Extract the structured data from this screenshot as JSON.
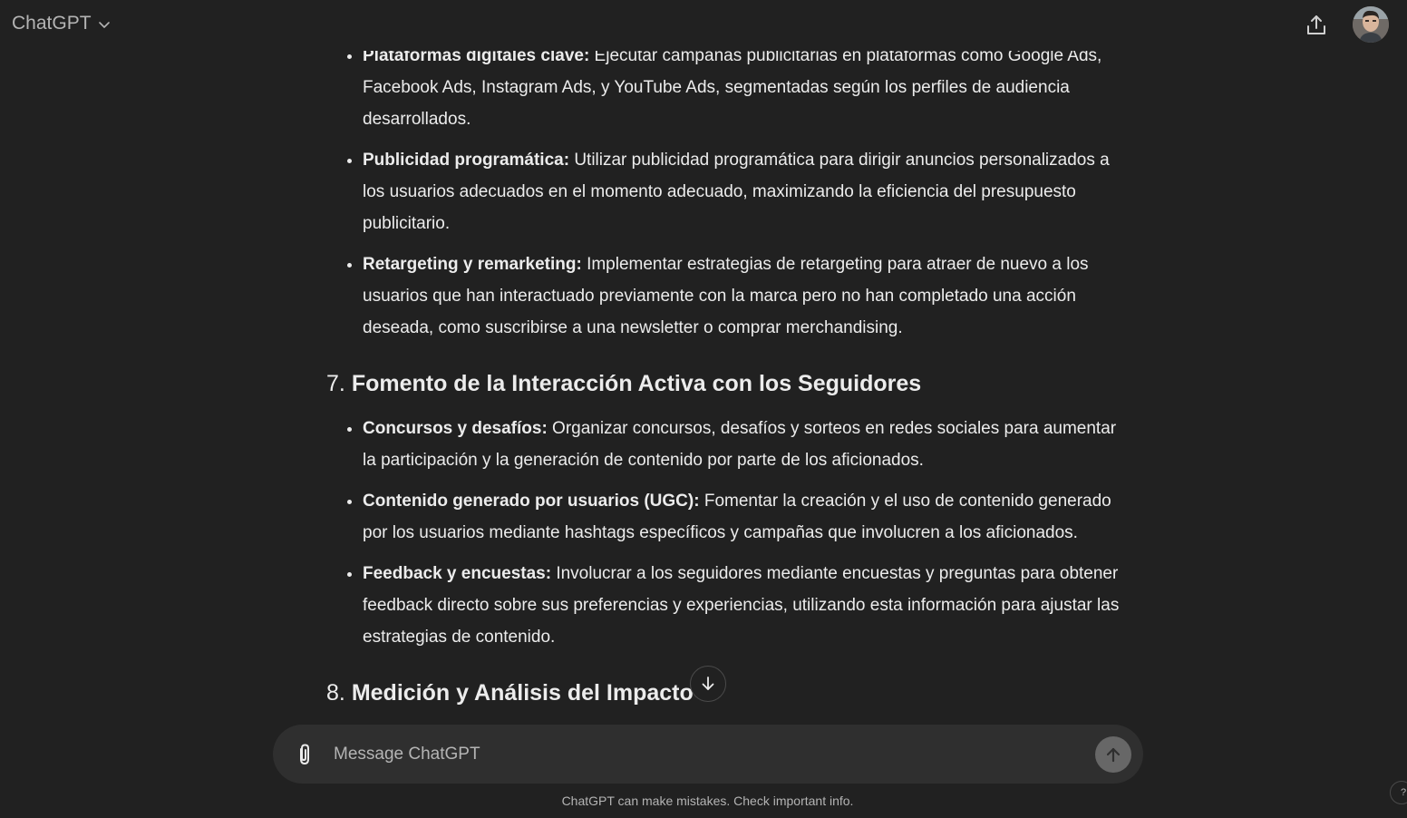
{
  "header": {
    "model_name": "ChatGPT",
    "icons": {
      "model_dropdown": "chevron-down-icon",
      "share": "share-icon",
      "avatar": "user-avatar"
    }
  },
  "message": {
    "section6_bullets": [
      {
        "title": "Plataformas digitales clave:",
        "text": " Ejecutar campañas publicitarias en plataformas como Google Ads, Facebook Ads, Instagram Ads, y YouTube Ads, segmentadas según los perfiles de audiencia desarrollados."
      },
      {
        "title": "Publicidad programática:",
        "text": " Utilizar publicidad programática para dirigir anuncios personalizados a los usuarios adecuados en el momento adecuado, maximizando la eficiencia del presupuesto publicitario."
      },
      {
        "title": "Retargeting y remarketing:",
        "text": " Implementar estrategias de retargeting para atraer de nuevo a los usuarios que han interactuado previamente con la marca pero no han completado una acción deseada, como suscribirse a una newsletter o comprar merchandising."
      }
    ],
    "section7": {
      "number": "7.",
      "heading": "Fomento de la Interacción Activa con los Seguidores",
      "bullets": [
        {
          "title": "Concursos y desafíos:",
          "text": " Organizar concursos, desafíos y sorteos en redes sociales para aumentar la participación y la generación de contenido por parte de los aficionados."
        },
        {
          "title": "Contenido generado por usuarios (UGC):",
          "text": " Fomentar la creación y el uso de contenido generado por los usuarios mediante hashtags específicos y campañas que involucren a los aficionados."
        },
        {
          "title": "Feedback y encuestas:",
          "text": " Involucrar a los seguidores mediante encuestas y preguntas para obtener feedback directo sobre sus preferencias y experiencias, utilizando esta información para ajustar las estrategias de contenido."
        }
      ]
    },
    "section8": {
      "number": "8.",
      "heading": "Medición y Análisis del Impacto"
    }
  },
  "composer": {
    "placeholder": "Message ChatGPT",
    "value": "",
    "icons": {
      "attach": "paperclip-icon",
      "send": "arrow-up-icon",
      "scroll": "arrow-down-icon"
    }
  },
  "footer": {
    "disclaimer": "ChatGPT can make mistakes. Check important info.",
    "help_label": "?"
  },
  "colors": {
    "background": "#212121",
    "composer": "#2f2f2f",
    "text": "#ececec",
    "muted": "#b4b4b4"
  }
}
